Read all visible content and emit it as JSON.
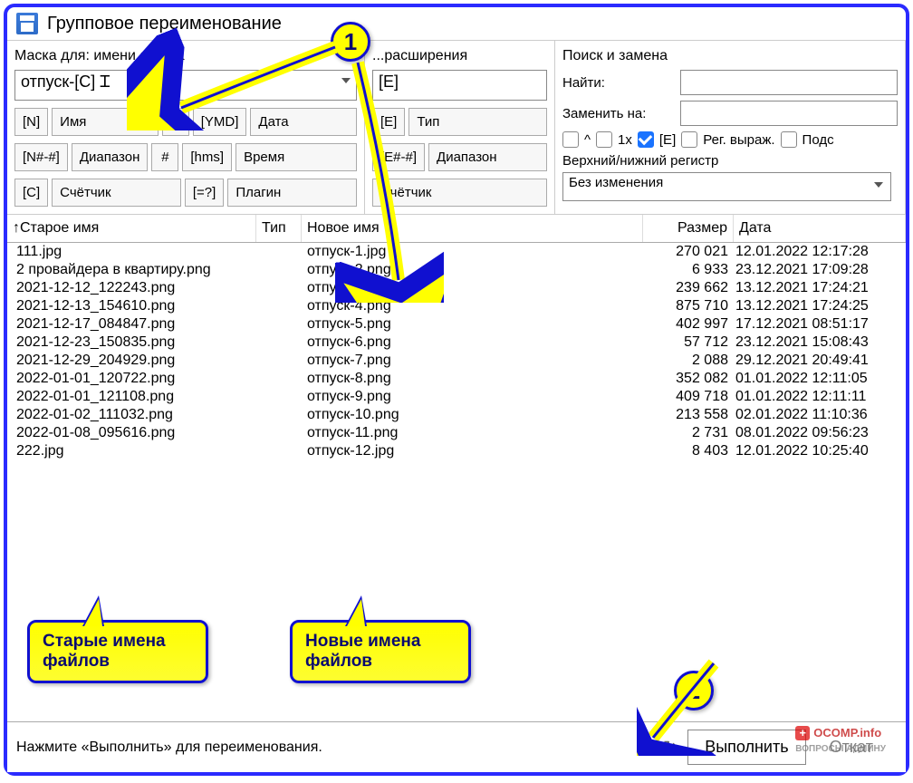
{
  "title": "Групповое переименование",
  "mask_filename_label": "Маска для: имени файла",
  "mask_ext_label": "...расширения",
  "mask_filename_value": "отпуск-[C]",
  "mask_ext_value": "[E]",
  "buttons_left": {
    "n": "[N]",
    "name": "Имя",
    "plus": "±",
    "ymd": "[YMD]",
    "date": "Дата",
    "range": "[N#-#]",
    "range_label": "Диапазон",
    "hash": "#",
    "hms": "[hms]",
    "time": "Время",
    "c": "[C]",
    "counter": "Счётчик",
    "eq": "[=?]",
    "plugin": "Плагин"
  },
  "buttons_mid": {
    "e": "[E]",
    "type": "Тип",
    "range": "[E#-#]",
    "range_label": "Диапазон",
    "counter": "Счётчик"
  },
  "search": {
    "title": "Поиск и замена",
    "find": "Найти:",
    "replace": "Заменить на:",
    "caret": "^",
    "once": "1x",
    "e_ck": "[E]",
    "regex": "Рег. выраж.",
    "subst": "Подс",
    "case_label": "Верхний/нижний регистр",
    "case_value": "Без изменения"
  },
  "columns": {
    "old": "↑Старое имя",
    "ext": "Тип",
    "new": "Новое имя",
    "size": "Размер",
    "date": "Дата"
  },
  "files": [
    {
      "old": "111.jpg",
      "new": "отпуск-1.jpg",
      "size": "270 021",
      "date": "12.01.2022 12:17:28"
    },
    {
      "old": "2 провайдера в квартиру.png",
      "new": "отпуск-2.png",
      "size": "6 933",
      "date": "23.12.2021 17:09:28"
    },
    {
      "old": "2021-12-12_122243.png",
      "new": "отпуск-3.png",
      "size": "239 662",
      "date": "13.12.2021 17:24:21"
    },
    {
      "old": "2021-12-13_154610.png",
      "new": "отпуск-4.png",
      "size": "875 710",
      "date": "13.12.2021 17:24:25"
    },
    {
      "old": "2021-12-17_084847.png",
      "new": "отпуск-5.png",
      "size": "402 997",
      "date": "17.12.2021 08:51:17"
    },
    {
      "old": "2021-12-23_150835.png",
      "new": "отпуск-6.png",
      "size": "57 712",
      "date": "23.12.2021 15:08:43"
    },
    {
      "old": "2021-12-29_204929.png",
      "new": "отпуск-7.png",
      "size": "2 088",
      "date": "29.12.2021 20:49:41"
    },
    {
      "old": "2022-01-01_120722.png",
      "new": "отпуск-8.png",
      "size": "352 082",
      "date": "01.01.2022 12:11:05"
    },
    {
      "old": "2022-01-01_121108.png",
      "new": "отпуск-9.png",
      "size": "409 718",
      "date": "01.01.2022 12:11:11"
    },
    {
      "old": "2022-01-02_111032.png",
      "new": "отпуск-10.png",
      "size": "213 558",
      "date": "02.01.2022 11:10:36"
    },
    {
      "old": "2022-01-08_095616.png",
      "new": "отпуск-11.png",
      "size": "2 731",
      "date": "08.01.2022 09:56:23"
    },
    {
      "old": "222.jpg",
      "new": "отпуск-12.jpg",
      "size": "8 403",
      "date": "12.01.2022 10:25:40"
    }
  ],
  "status_msg": "Нажмите «Выполнить» для переименования.",
  "btn_execute": "Выполнить",
  "btn_undo": "Откат",
  "annotations": {
    "badge1": "1",
    "badge2": "2",
    "callout_old": "Старые имена файлов",
    "callout_new": "Новые имена файлов"
  },
  "watermark": "OCOMP.info"
}
